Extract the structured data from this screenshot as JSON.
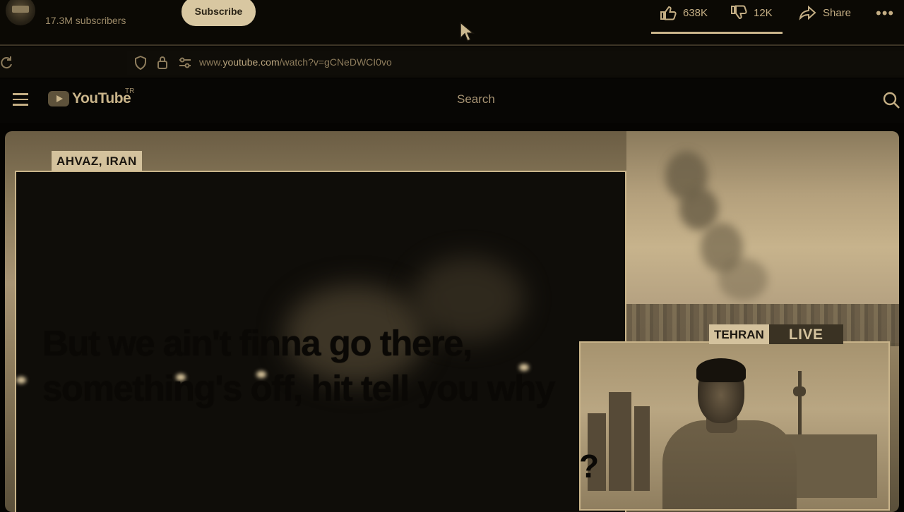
{
  "channel": {
    "subscribers": "17.3M subscribers",
    "subscribe_label": "Subscribe"
  },
  "actions": {
    "likes": "638K",
    "dislikes": "12K",
    "share": "Share",
    "more": "•••"
  },
  "browser": {
    "url_prefix": "www.",
    "url_domain": "youtube.com",
    "url_path": "/watch?v=gCNeDWCI0vo"
  },
  "youtube": {
    "logo_text": "YouTube",
    "country_code": "TR",
    "search_placeholder": "Search"
  },
  "video": {
    "location_tag": "AHVAZ, IRAN",
    "caption_line1": "But we ain't finna go there,",
    "caption_line2": "something's off, hit tell you why",
    "caption_line3": "?",
    "pip_city": "TEHRAN",
    "pip_live": "LIVE"
  },
  "colors": {
    "accent": "#c9b48a",
    "tag_bg": "#d4c29d",
    "background": "#050402"
  },
  "icons": [
    "refresh-icon",
    "shield-icon",
    "lock-icon",
    "permissions-icon",
    "menu-icon",
    "search-icon",
    "like-icon",
    "dislike-icon",
    "share-icon",
    "cursor-icon"
  ]
}
